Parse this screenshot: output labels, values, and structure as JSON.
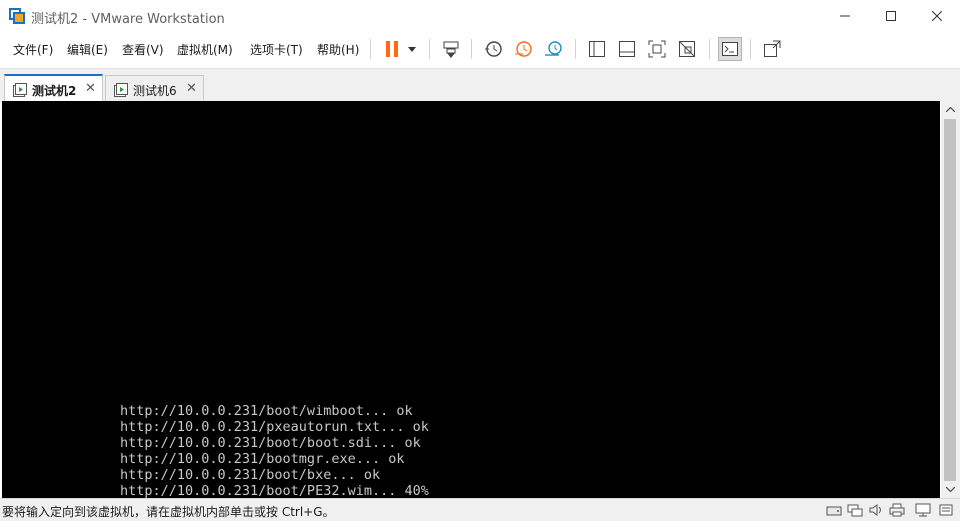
{
  "window": {
    "title": "测试机2 - VMware Workstation"
  },
  "menu": {
    "items": [
      "文件(F)",
      "编辑(E)",
      "查看(V)",
      "虚拟机(M)",
      "选项卡(T)",
      "帮助(H)"
    ]
  },
  "toolbar": {
    "buttons": [
      "pause-icon",
      "dropdown-arrow-icon",
      "send-keys-icon",
      "snapshot-icon",
      "revert-snapshot-icon",
      "snapshot-manager-icon",
      "library-icon",
      "thumbnail-icon",
      "fullscreen-icon",
      "unity-icon",
      "console-view-icon",
      "stretch-icon"
    ],
    "accent_color": "#ff6a13"
  },
  "tabs": [
    {
      "label": "测试机2",
      "active": true
    },
    {
      "label": "测试机6",
      "active": false
    }
  ],
  "console": {
    "lines": [
      "http://10.0.0.231/boot/wimboot... ok",
      "http://10.0.0.231/pxeautorun.txt... ok",
      "http://10.0.0.231/boot/boot.sdi... ok",
      "http://10.0.0.231/bootmgr.exe... ok",
      "http://10.0.0.231/boot/bxe... ok",
      "http://10.0.0.231/boot/PE32.wim... 40%"
    ]
  },
  "statusbar": {
    "text": "要将输入定向到该虚拟机，请在虚拟机内部单击或按 Ctrl+G。",
    "icons": [
      "hard-disk-icon",
      "network-icon",
      "cd-rom-icon",
      "sound-icon",
      "printer-icon",
      "display-icon"
    ]
  }
}
